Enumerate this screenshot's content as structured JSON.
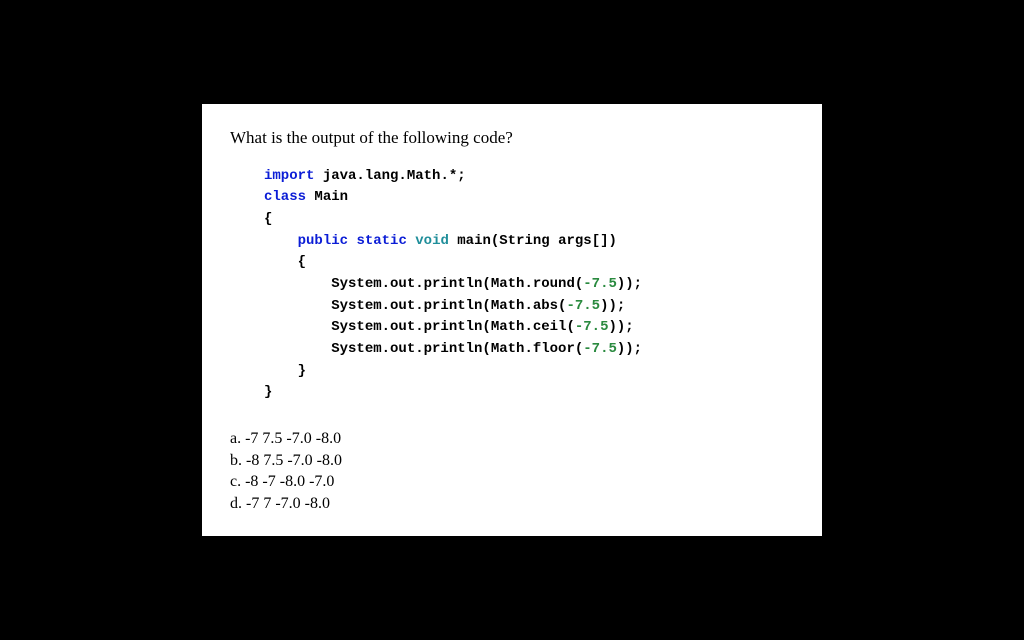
{
  "question": "What is the output of the following code?",
  "code": {
    "l1_kw": "import",
    "l1_rest": " java.lang.Math.*;",
    "l2_kw": "class",
    "l2_rest": " Main",
    "l3": "{",
    "l4_kw1": "public",
    "l4_kw2": "static",
    "l4_kw3": "void",
    "l4_rest1": " main(String args[])",
    "l5": "    {",
    "l6a": "        System.out.println(Math.round(",
    "l6n": "-7.5",
    "l6b": "));",
    "l7a": "        System.out.println(Math.abs(",
    "l7n": "-7.5",
    "l7b": "));",
    "l8a": "        System.out.println(Math.ceil(",
    "l8n": "-7.5",
    "l8b": "));",
    "l9a": "        System.out.println(Math.floor(",
    "l9n": "-7.5",
    "l9b": "));",
    "l10": "    }",
    "l11": "}"
  },
  "options": {
    "a": "a. -7 7.5 -7.0 -8.0",
    "b": "b. -8 7.5 -7.0 -8.0",
    "c": "c. -8 -7 -8.0 -7.0",
    "d": "d. -7 7 -7.0 -8.0"
  }
}
